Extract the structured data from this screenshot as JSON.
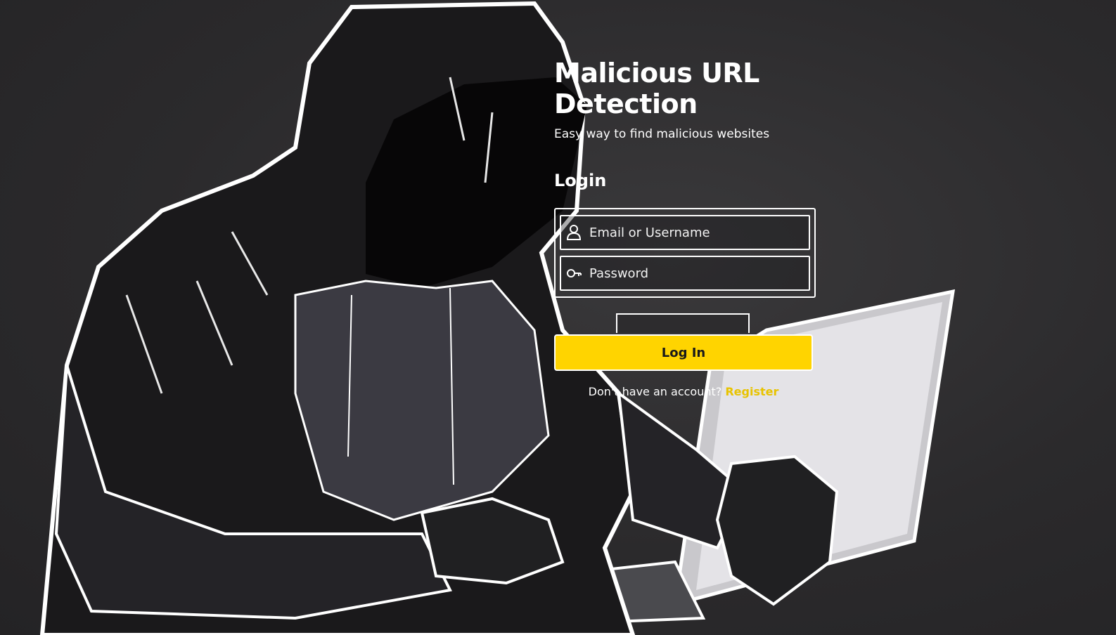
{
  "app": {
    "title": "Malicious URL Detection",
    "tagline": "Easy way to find malicious websites"
  },
  "login": {
    "heading": "Login",
    "username_placeholder": "Email or Username",
    "password_placeholder": "Password",
    "submit_label": "Log In",
    "register_prompt": "Don't have an account?",
    "register_link": "Register"
  },
  "icons": {
    "username": "user-icon",
    "password": "key-icon"
  },
  "colors": {
    "background": "#2b2a2c",
    "accent": "#ffd400",
    "link": "#e8c300",
    "text": "#ffffff"
  }
}
